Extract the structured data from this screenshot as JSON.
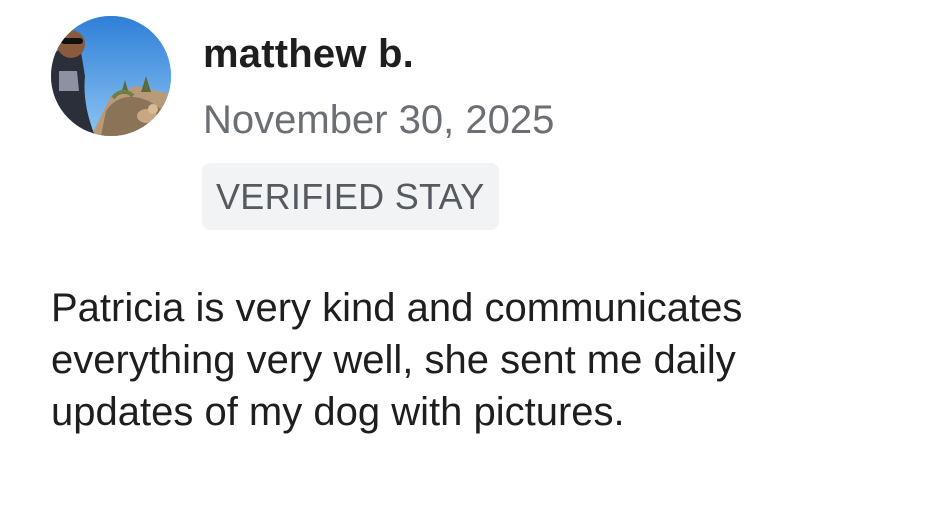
{
  "review": {
    "avatar_icon": "user-avatar-photo",
    "author_name": "matthew b.",
    "date": "November 30, 2025",
    "badge": "VERIFIED STAY",
    "text": "Patricia is very kind and communicates\neverything very well, she sent me daily\nupdates of my dog with pictures."
  },
  "colors": {
    "name_text": "#1e1e1e",
    "date_text": "#6b6f75",
    "badge_bg": "#f2f3f5",
    "badge_text": "#555a60"
  }
}
